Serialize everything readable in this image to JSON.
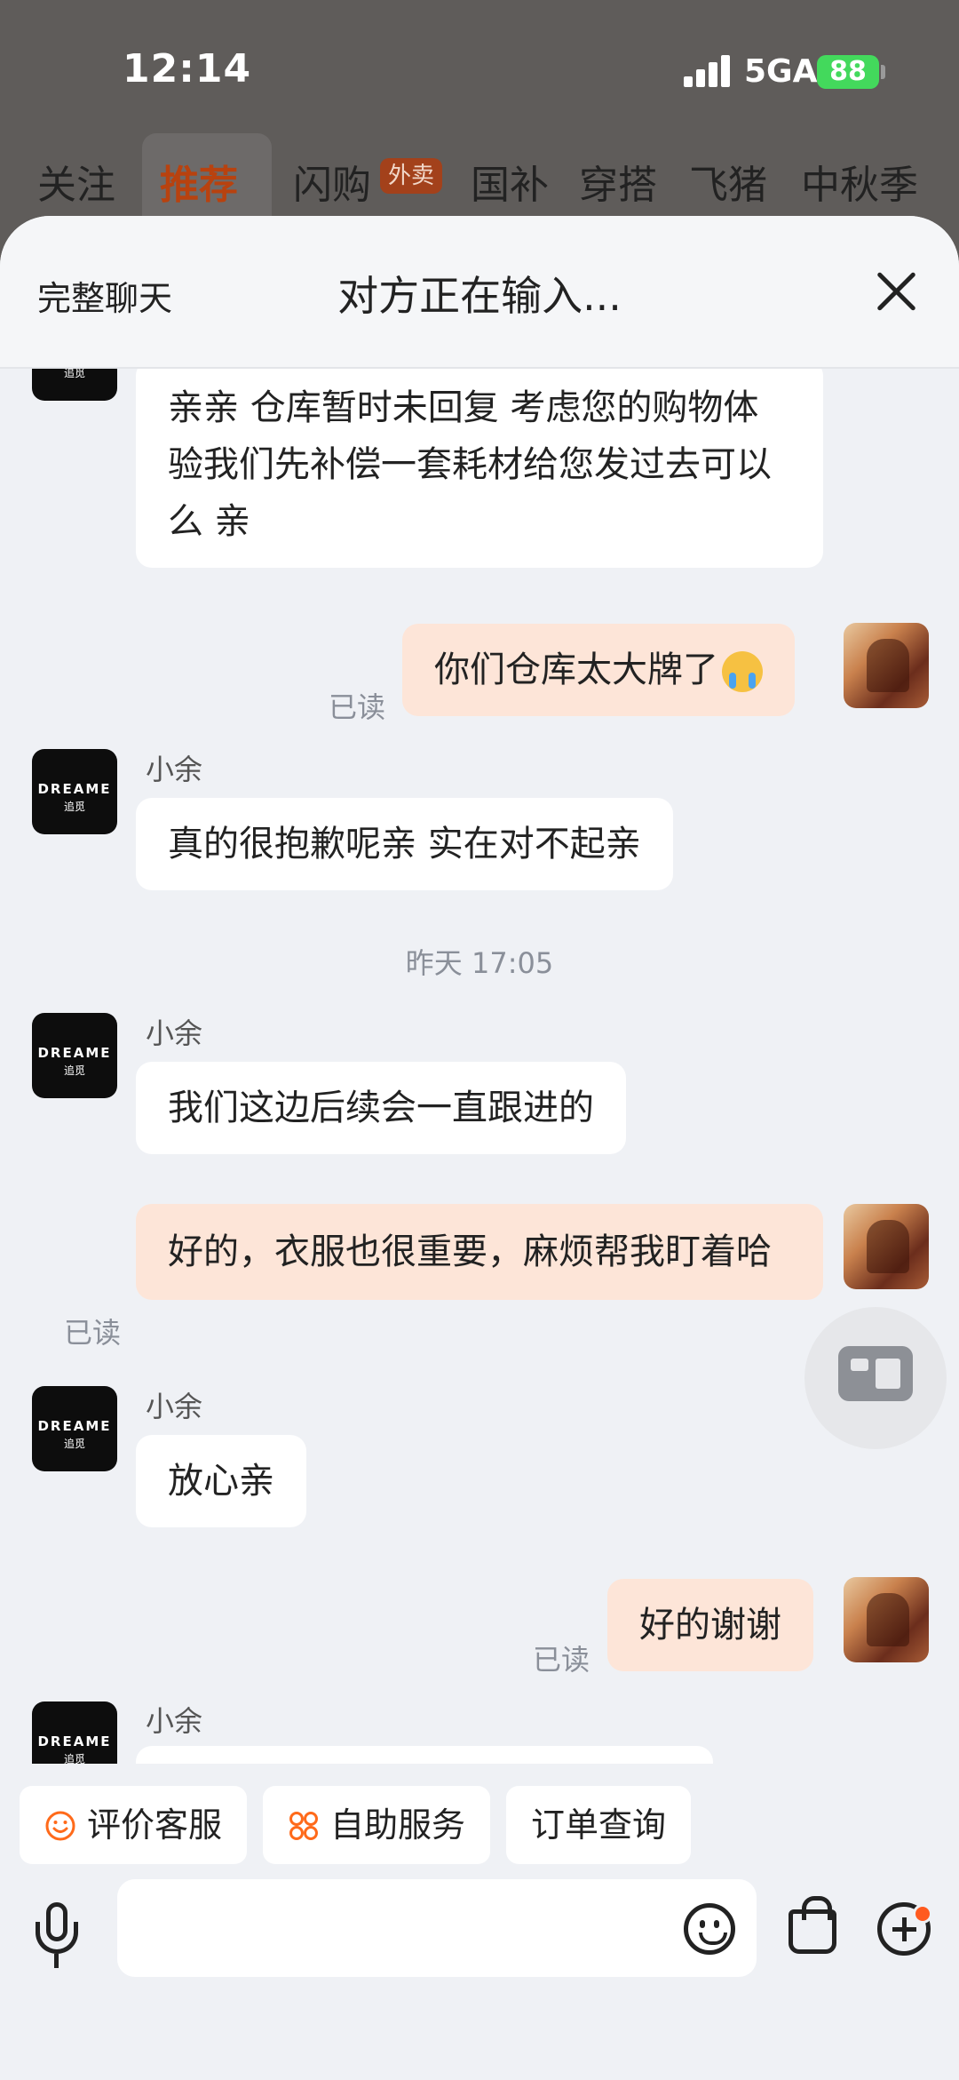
{
  "status_bar": {
    "time": "12:14",
    "network": "5GA",
    "battery": "88"
  },
  "top_tabs": [
    "关注",
    "推荐",
    "闪购",
    "国补",
    "穿搭",
    "飞猪",
    "中秋季"
  ],
  "top_tab_badge": "外卖",
  "chat_header": {
    "full_chat": "完整聊天",
    "title": "对方正在输入..."
  },
  "shop_avatar": {
    "brand": "DREAME",
    "brand_cn": "追觅"
  },
  "messages": [
    {
      "side": "left",
      "text": "亲亲 仓库暂时未回复 考虑您的购物体验我们先补偿一套耗材给您发过去可以么 亲"
    },
    {
      "side": "right",
      "text": "你们仓库太大牌了",
      "emoji": "crying-face",
      "read": "已读"
    },
    {
      "side": "left",
      "sender": "小余",
      "text": "真的很抱歉呢亲 实在对不起亲"
    },
    {
      "type": "time",
      "text": "昨天 17:05"
    },
    {
      "side": "left",
      "sender": "小余",
      "text": "我们这边后续会一直跟进的"
    },
    {
      "side": "right",
      "text": "好的，衣服也很重要，麻烦帮我盯着哈",
      "read": "已读"
    },
    {
      "side": "left",
      "sender": "小余",
      "text": "放心亲"
    },
    {
      "side": "right",
      "text": "好的谢谢",
      "read": "已读"
    },
    {
      "side": "left",
      "sender": "小余",
      "text": ""
    }
  ],
  "quick_actions": [
    "评价客服",
    "自助服务",
    "订单查询"
  ],
  "input": {
    "placeholder": ""
  },
  "colors": {
    "accent": "#ff6a1a",
    "bubble_mine": "#fde5d8",
    "background": "#eff1f5"
  }
}
